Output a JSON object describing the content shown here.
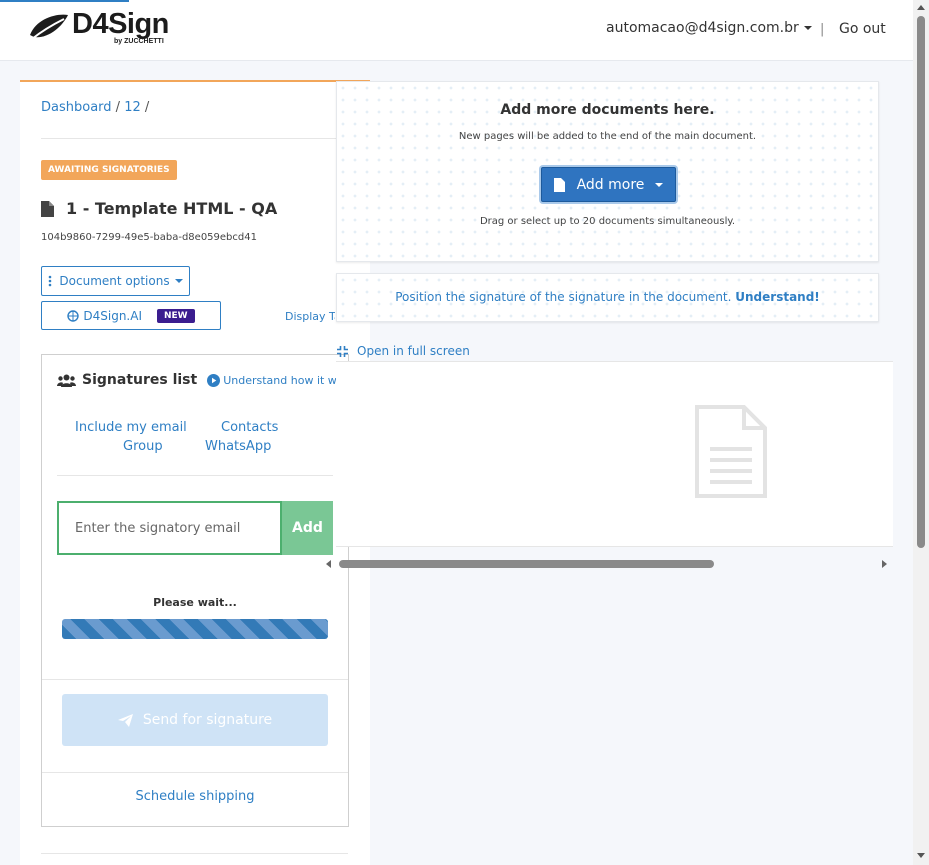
{
  "header": {
    "logo_text": "D4Sign",
    "logo_sub": "by ZUCCHETTI",
    "user_email": "automacao@d4sign.com.br",
    "separator": "|",
    "logout_label": "Go out"
  },
  "breadcrumb": {
    "items": [
      "Dashboard",
      "12"
    ],
    "separator": "/"
  },
  "document": {
    "status": "AWAITING SIGNATORIES",
    "title": "1 - Template HTML - QA",
    "id": "104b9860-7299-49e5-baba-d8e059ebcd41",
    "options_label": "Document options",
    "ai_label": "D4Sign.AI",
    "ai_badge": "NEW",
    "display_label": "Display Ta"
  },
  "signatures": {
    "title": "Signatures list",
    "understand_label": "Understand how it works",
    "options": {
      "include_email": "Include my email",
      "contacts": "Contacts",
      "group": "Group",
      "whatsapp": "WhatsApp"
    },
    "email_placeholder": "Enter the signatory email",
    "add_label": "Add",
    "wait_text": "Please wait...",
    "send_label": "Send for signature",
    "schedule_label": "Schedule shipping"
  },
  "upload": {
    "title": "Add more documents here.",
    "subtitle": "New pages will be added to the end of the main document.",
    "button_label": "Add more",
    "hint": "Drag or select up to 20 documents simultaneously."
  },
  "position": {
    "text": "Position the signature of the signature in the document.",
    "link": "Understand!"
  },
  "viewer": {
    "fullscreen_label": "Open in full screen"
  },
  "colors": {
    "accent": "#2f7fc4",
    "status": "#f2a65a",
    "add_button": "#7ac795",
    "ai_badge": "#3b1d8f"
  }
}
